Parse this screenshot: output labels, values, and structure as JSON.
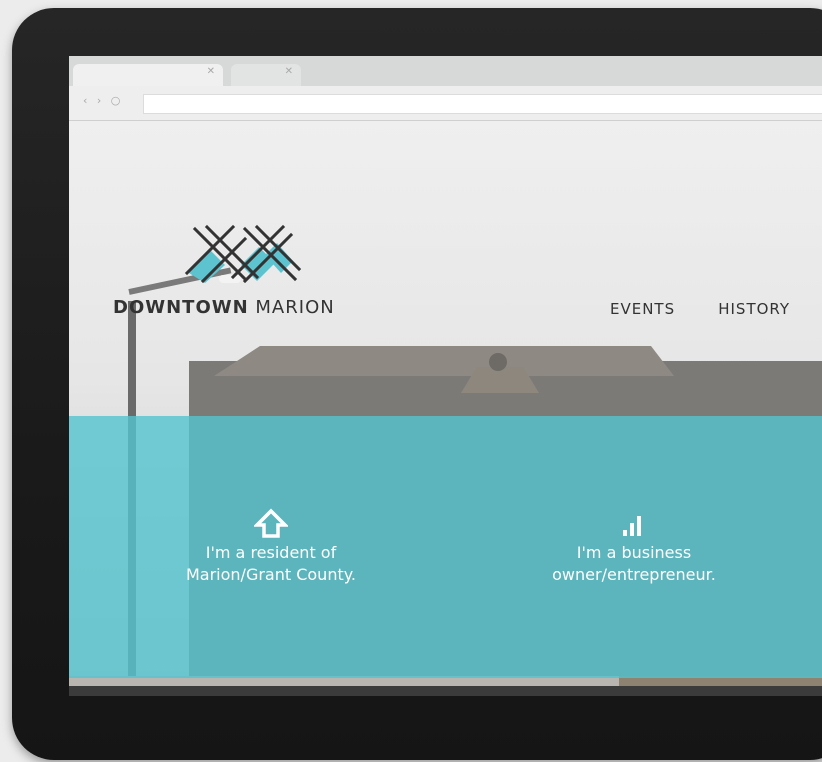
{
  "browser": {
    "nav_glyphs": "‹ › ○"
  },
  "header": {
    "brand_bold": "DOWNTOWN",
    "brand_rest": "MARION",
    "nav": [
      {
        "label": "EVENTS"
      },
      {
        "label": "HISTORY"
      }
    ]
  },
  "cta": [
    {
      "icon": "house-arrow-icon",
      "line1": "I'm a resident of",
      "line2": "Marion/Grant County."
    },
    {
      "icon": "bar-chart-icon",
      "line1": "I'm a business",
      "line2": "owner/entrepreneur."
    }
  ],
  "colors": {
    "teal": "#54c4d0",
    "logo_accent": "#5cc3cf",
    "text_dark": "#333333",
    "bezel": "#1f1f1f"
  }
}
